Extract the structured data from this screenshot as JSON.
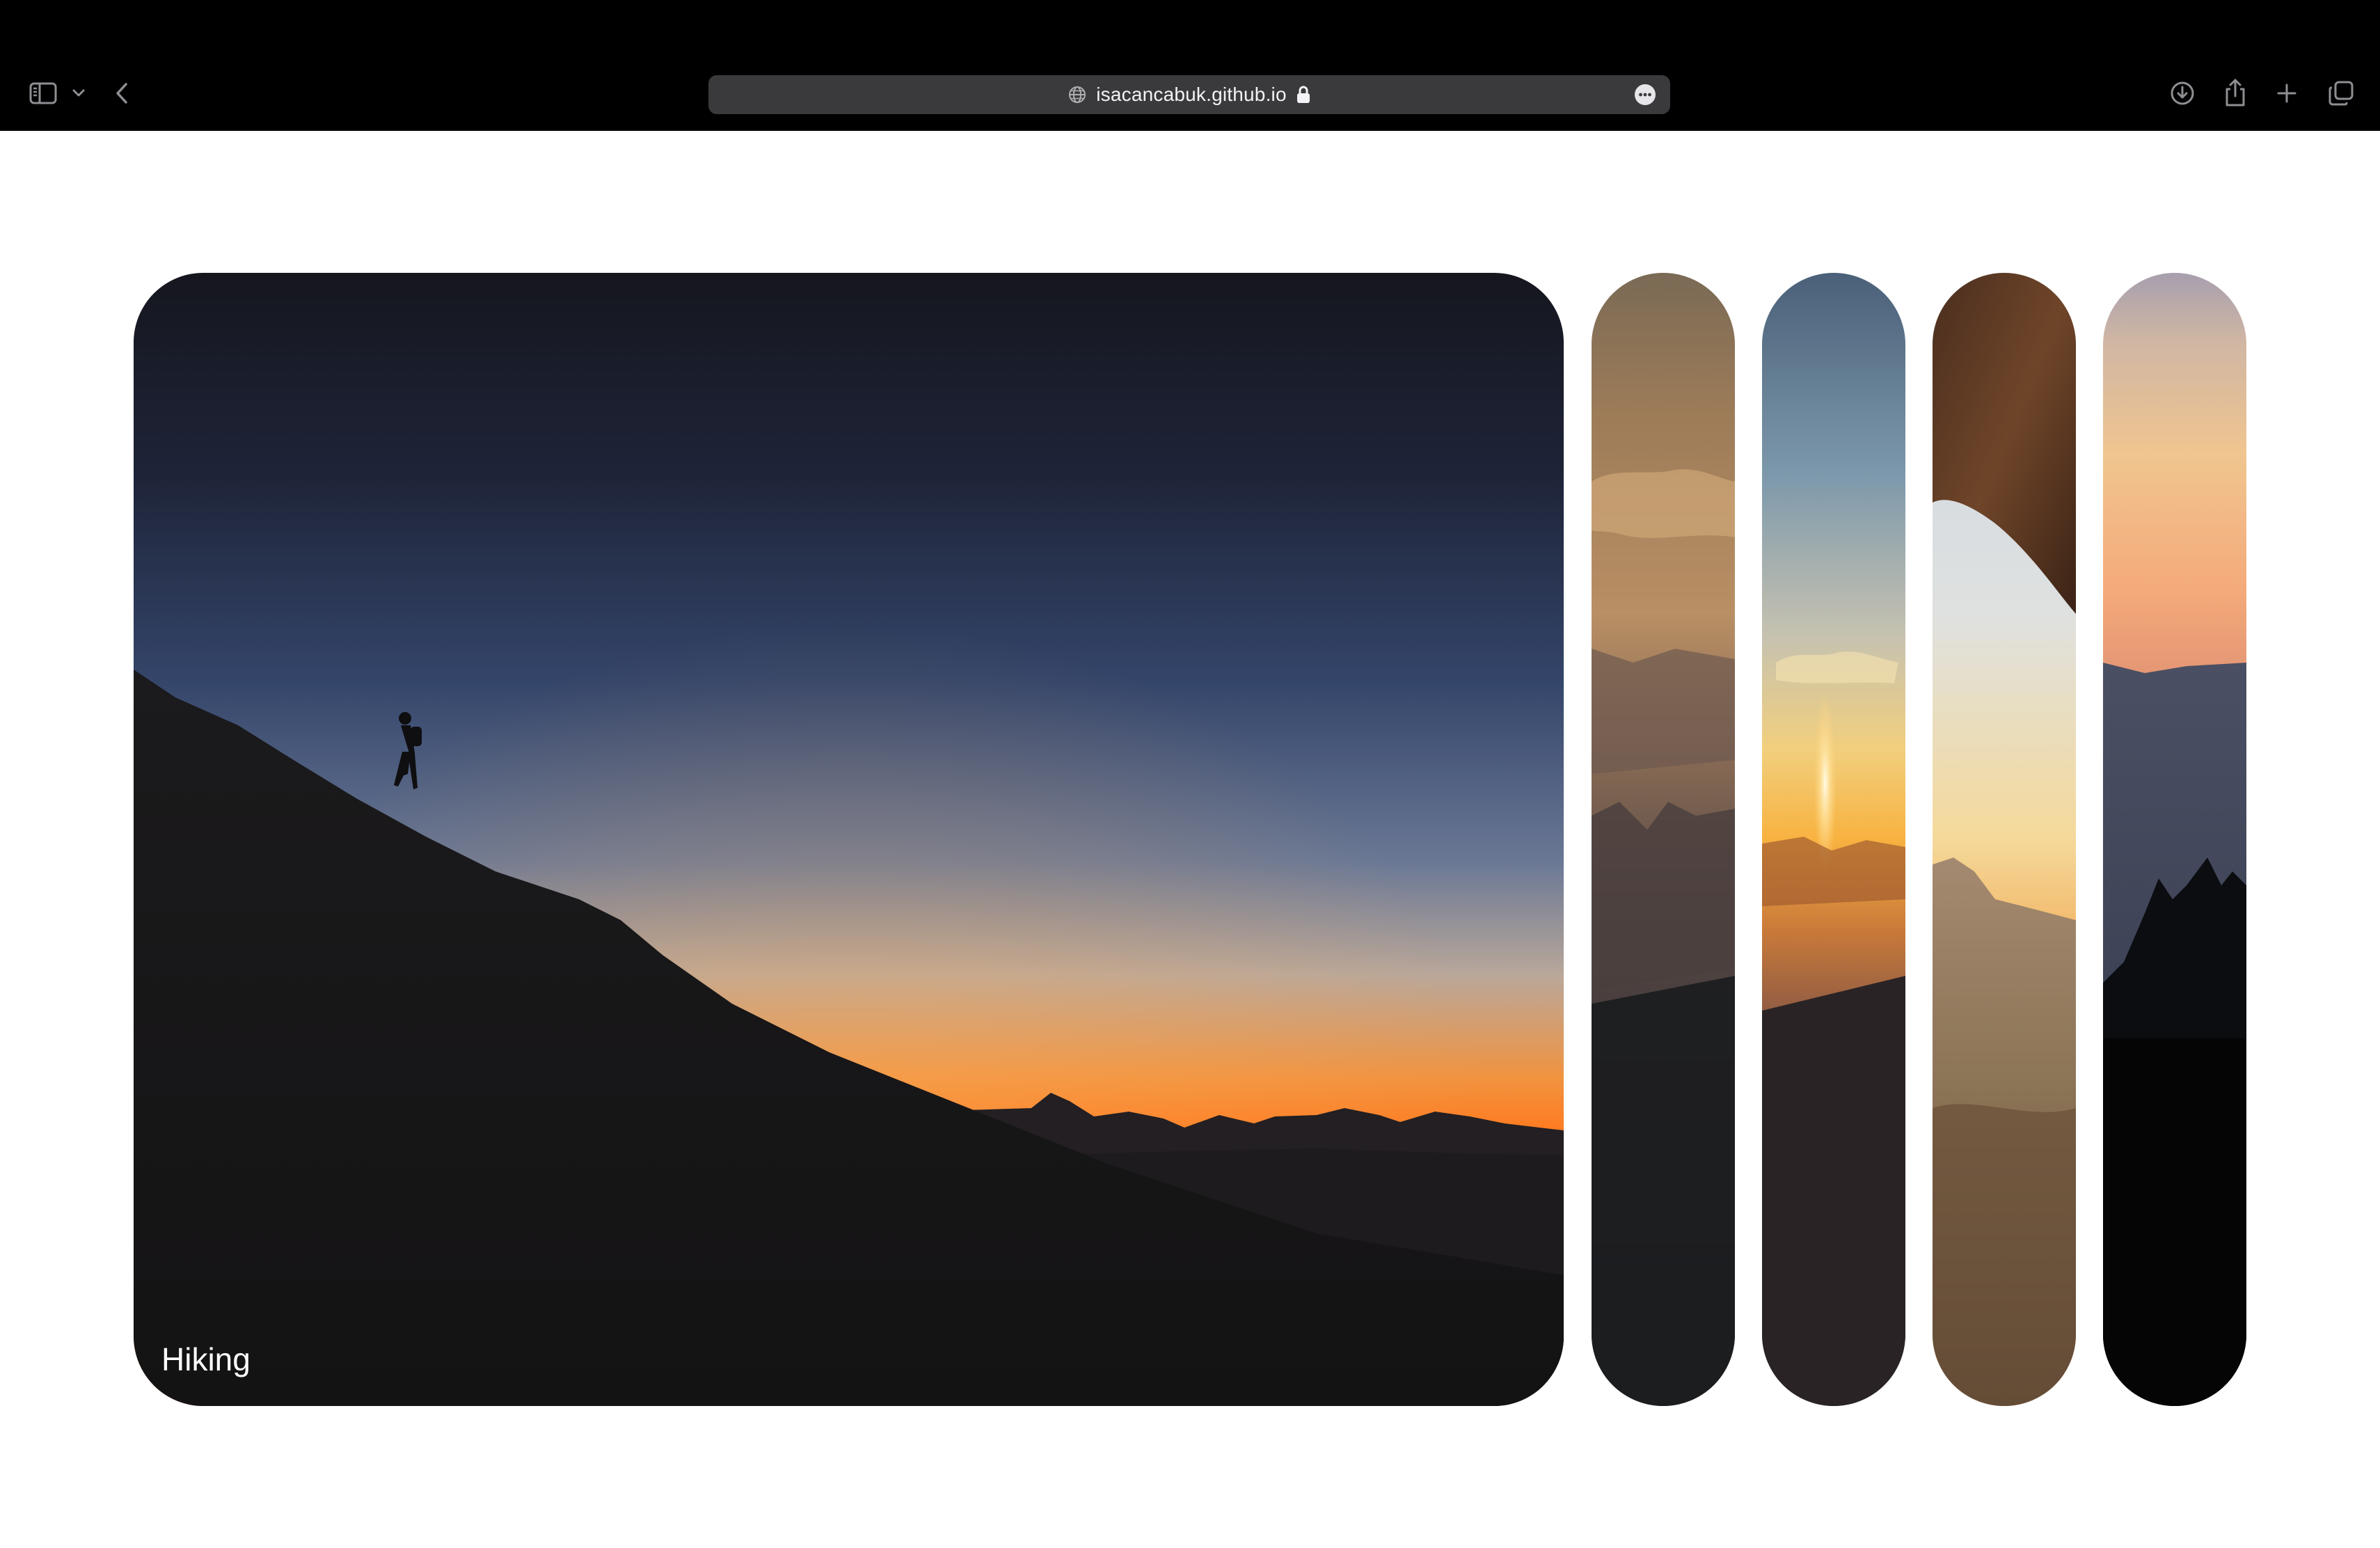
{
  "browser": {
    "url": "isacancabuk.github.io",
    "icons": {
      "sidebar": "sidebar-icon",
      "sidebar_menu": "chevron-down-icon",
      "back": "chevron-left-icon",
      "site_info": "globe-icon",
      "secure": "lock-icon",
      "page_menu": "more-icon",
      "downloads": "download-icon",
      "share": "share-icon",
      "new_tab": "plus-icon",
      "tab_overview": "tabs-icon"
    }
  },
  "gallery": {
    "active_label": "Hiking",
    "cards": [
      {
        "image": "hiker silhouette on ridge at dusk",
        "active": true
      },
      {
        "image": "canyon rock formations under clouds",
        "active": false
      },
      {
        "image": "sun setting over desert valley",
        "active": false
      },
      {
        "image": "view through sandstone arch",
        "active": false
      },
      {
        "image": "mountains with pine silhouettes at sunset",
        "active": false
      }
    ]
  },
  "colors": {
    "chrome_background": "#000000",
    "address_bar": "#3a3a3c",
    "page_background": "#ffffff",
    "label_text": "#ffffff"
  }
}
